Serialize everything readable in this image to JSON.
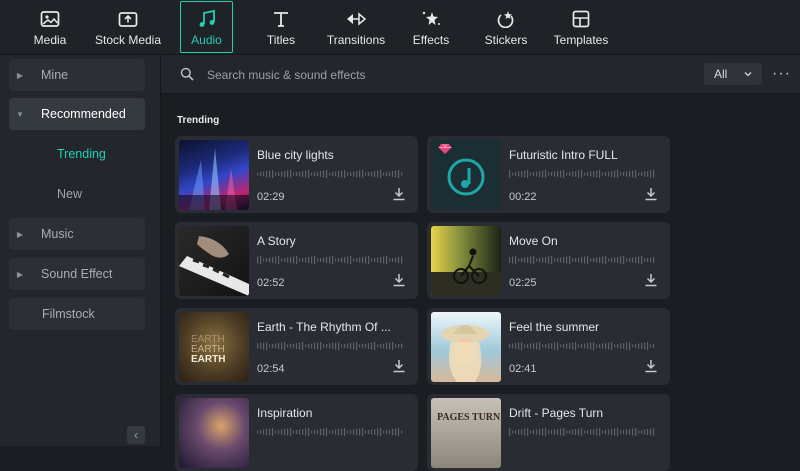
{
  "toolbar": {
    "tabs": [
      {
        "label": "Media",
        "icon": "media-icon"
      },
      {
        "label": "Stock Media",
        "icon": "stock-media-icon"
      },
      {
        "label": "Audio",
        "icon": "music-note-icon",
        "active": true
      },
      {
        "label": "Titles",
        "icon": "titles-icon"
      },
      {
        "label": "Transitions",
        "icon": "transitions-icon"
      },
      {
        "label": "Effects",
        "icon": "effects-icon"
      },
      {
        "label": "Stickers",
        "icon": "stickers-icon"
      },
      {
        "label": "Templates",
        "icon": "templates-icon"
      }
    ]
  },
  "sidebar": {
    "items": [
      {
        "label": "Mine"
      },
      {
        "label": "Recommended",
        "expanded": true
      },
      {
        "label": "Trending",
        "active": true
      },
      {
        "label": "New"
      },
      {
        "label": "Music"
      },
      {
        "label": "Sound Effect"
      },
      {
        "label": "Filmstock"
      }
    ]
  },
  "search": {
    "placeholder": "Search music & sound effects",
    "value": ""
  },
  "filter": {
    "selected": "All"
  },
  "section": {
    "title": "Trending"
  },
  "tracks": [
    {
      "title": "Blue city lights",
      "duration": "02:29",
      "premium": false
    },
    {
      "title": "Futuristic Intro FULL",
      "duration": "00:22",
      "premium": true
    },
    {
      "title": "A Story",
      "duration": "02:52",
      "premium": false
    },
    {
      "title": "Move On",
      "duration": "02:25",
      "premium": false
    },
    {
      "title": "Earth - The Rhythm Of ...",
      "duration": "02:54",
      "premium": false,
      "thumb_text": [
        "EARTH",
        "EARTH",
        "EARTH"
      ]
    },
    {
      "title": "Feel the summer",
      "duration": "02:41",
      "premium": false
    },
    {
      "title": "Inspiration",
      "duration": "",
      "premium": false
    },
    {
      "title": "Drift - Pages Turn",
      "duration": "",
      "premium": false,
      "thumb_text": [
        "PAGES TURN"
      ]
    }
  ],
  "colors": {
    "accent": "#22d0b2",
    "background": "#1a1d22",
    "card": "#292d33",
    "premium": "#e8457a"
  }
}
